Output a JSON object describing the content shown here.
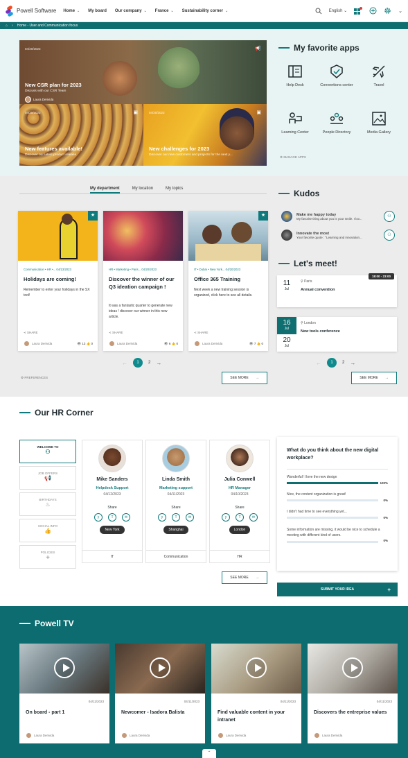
{
  "nav": {
    "brand": "Powell Software",
    "items": [
      "Home",
      "My board",
      "Our company",
      "France",
      "Sustainability corner"
    ],
    "language": "English"
  },
  "breadcrumb": "Home - User and Communication focus",
  "hero": {
    "main": {
      "date": "04/20/2023",
      "title": "New CSR plan for 2023",
      "subtitle": "Discuss with our CSR Team",
      "author": "Laura Derivida"
    },
    "left": {
      "date": "04/20/2023",
      "title": "New features available!",
      "subtitle": "Discover our latest product release"
    },
    "right": {
      "date": "04/20/2023",
      "title": "New challenges for 2023",
      "subtitle": "Discover our new customers and projects for the next y..."
    }
  },
  "apps": {
    "title": "My favorite apps",
    "items": [
      "Help Desk",
      "Conventions center",
      "Travel",
      "Learning Center",
      "People Directory",
      "Media Gallery"
    ],
    "manage": "MANAGE APPS"
  },
  "department": {
    "tabs": [
      "My department",
      "My location",
      "My topics"
    ],
    "cards": [
      {
        "meta": "Communication • HR •... 04/13/2023",
        "title": "Holidays are coming!",
        "desc": "Remember to enter your holidays in the SX tool!",
        "share": "SHARE",
        "author": "Laura Derivida",
        "stats": "👁 13  👍 0"
      },
      {
        "meta": "HR • Marketing • Paris... 04/20/2023",
        "title": "Discover the winner of our Q3 ideation campaign !",
        "desc": "It was a fantastic quarter to generate new ideas ! discover our winner in this new article.",
        "share": "SHARE",
        "author": "Laura Derivida",
        "stats": "👁 6  👍 0"
      },
      {
        "meta": "IT • Dubai • New York... 04/20/2023",
        "title": "Office 365 Training",
        "desc": "Next week a new training session is organized, click here to see all details.",
        "share": "SHARE",
        "author": "Laura Derivida",
        "stats": "👁 7  👍 0"
      }
    ],
    "pages": [
      "1",
      "2"
    ],
    "preferences": "PREFERENCES",
    "see_more": "SEE MORE"
  },
  "kudos": {
    "title": "Kudos",
    "items": [
      {
        "title": "Make me happy today",
        "text": "My favorite thing about you is your smile. I lov..."
      },
      {
        "title": "Innovate the most",
        "text": "Your favorite quote : \"Learning and innovation..."
      }
    ]
  },
  "meet": {
    "title": "Let's meet!",
    "events": [
      {
        "day": "11",
        "month": "Jul",
        "time": "18:00 - 23:00",
        "place": "Paris",
        "title": "Annual convention"
      },
      {
        "day": "16",
        "month": "Jul",
        "day2": "20",
        "month2": "Jul",
        "place": "London",
        "title": "New tools conference"
      }
    ],
    "pages": [
      "1",
      "2"
    ],
    "see_more": "SEE MORE"
  },
  "hr": {
    "title": "Our HR Corner",
    "tabs": [
      "WELCOME TO",
      "JOB OFFERS",
      "BIRTHDAYS",
      "SOCIAL INFO",
      "POLICIES"
    ],
    "people": [
      {
        "name": "Mike Sanders",
        "role": "Helpdesk Support",
        "date": "04/12/2023",
        "share": "Share",
        "city": "New York",
        "dept": "IT"
      },
      {
        "name": "Linda Smith",
        "role": "Marketing support",
        "date": "04/11/2023",
        "share": "Share",
        "city": "Shanghai",
        "dept": "Communication"
      },
      {
        "name": "Julia Conwell",
        "role": "HR Manager",
        "date": "04/10/2023",
        "share": "Share",
        "city": "London",
        "dept": "HR"
      }
    ],
    "see_more": "SEE MORE"
  },
  "poll": {
    "question": "What do you think about the new digital workplace?",
    "options": [
      {
        "text": "Wonderful! I love the new design",
        "pct": "100%",
        "value": 1.0
      },
      {
        "text": "Nice, the content organization is great!",
        "pct": "0%",
        "value": 0
      },
      {
        "text": "I didn't had time to see everything yet...",
        "pct": "0%",
        "value": 0
      },
      {
        "text": "Some information are missing, it would be nice to schedule a meeting with different kind of users.",
        "pct": "0%",
        "value": 0
      }
    ],
    "submit": "SUBMIT YOUR IDEA"
  },
  "tv": {
    "title": "Powell TV",
    "videos": [
      {
        "date": "04/11/2023",
        "title": "On board - part 1",
        "author": "Laura Derivida"
      },
      {
        "date": "04/11/2023",
        "title": "Newcomer - Isadora Balista",
        "author": "Laura Derivida"
      },
      {
        "date": "04/11/2023",
        "title": "Find valuable content in your intranet",
        "author": "Laura Derivida"
      },
      {
        "date": "04/11/2023",
        "title": "Discovers the entreprise values",
        "author": "Laura Derivida"
      }
    ]
  },
  "colors": {
    "accent": "#0f7a7c",
    "tv_bg": "#0c6c6f",
    "hero_bg": "#e8f3f3"
  }
}
